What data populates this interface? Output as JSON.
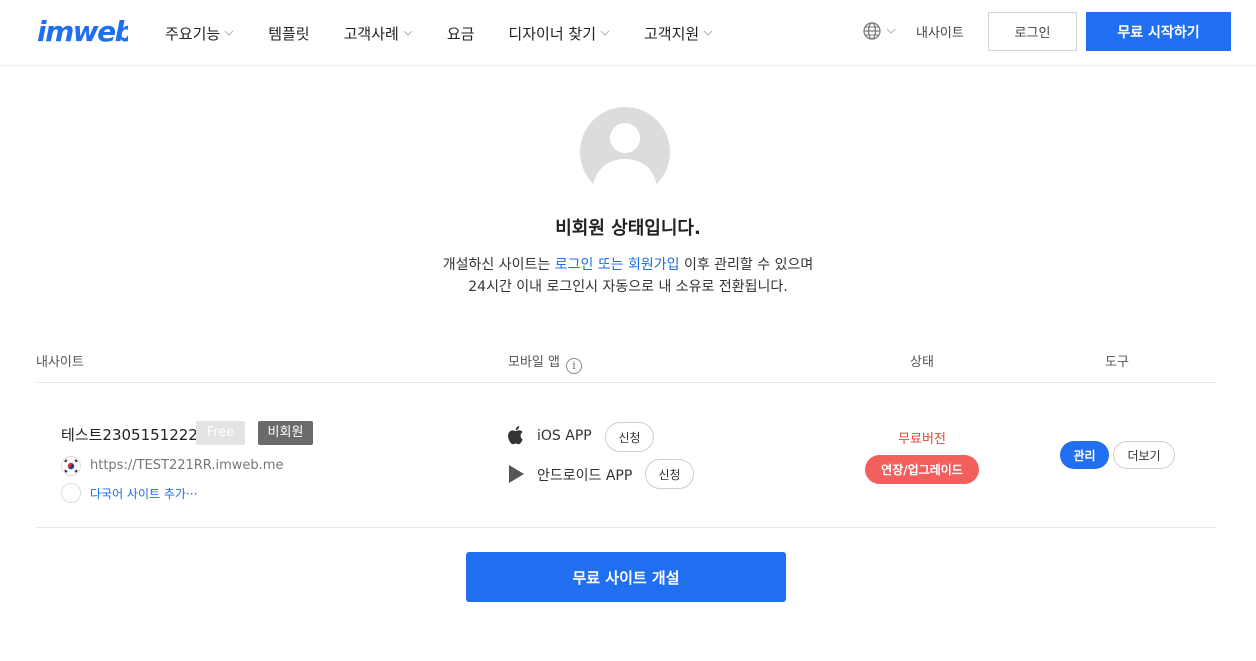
{
  "header": {
    "logo_text": "imweb",
    "nav": [
      {
        "label": "주요기능",
        "has_dropdown": true
      },
      {
        "label": "템플릿",
        "has_dropdown": false
      },
      {
        "label": "고객사례",
        "has_dropdown": true
      },
      {
        "label": "요금",
        "has_dropdown": false
      },
      {
        "label": "디자이너 찾기",
        "has_dropdown": true
      },
      {
        "label": "고객지원",
        "has_dropdown": true
      }
    ],
    "language_icon": "globe-icon",
    "my_site": "내사이트",
    "login": "로그인",
    "start_free": "무료 시작하기"
  },
  "profile": {
    "avatar_icon": "user-avatar-icon",
    "status_title": "비회원 상태입니다.",
    "desc_line1_pre": "개설하신 사이트는 ",
    "desc_line1_link": "로그인 또는 회원가입",
    "desc_line1_post": " 이후 관리할 수 있으며",
    "desc_line2": "24시간 이내 로그인시 자동으로 내 소유로 전환됩니다."
  },
  "table": {
    "headers": {
      "site": "내사이트",
      "mobile_app": "모바일 앱",
      "info": "i",
      "status": "상태",
      "tools": "도구"
    },
    "row": {
      "site_name": "테스트2305151222",
      "plan_badge": "Free",
      "member_badge": "비회원",
      "url": "https://TEST221RR.imweb.me",
      "add_language": "다국어 사이트 추가···",
      "ios_label": "iOS APP",
      "ios_apply": "신청",
      "android_label": "안드로이드 APP",
      "android_apply": "신청",
      "status_text": "무료버전",
      "upgrade": "연장/업그레이드",
      "manage": "관리",
      "more": "더보기"
    }
  },
  "create_site": "무료 사이트 개설",
  "colors": {
    "accent": "#1f6ff0",
    "danger": "#e5453d",
    "upgrade": "#f25f5c"
  }
}
